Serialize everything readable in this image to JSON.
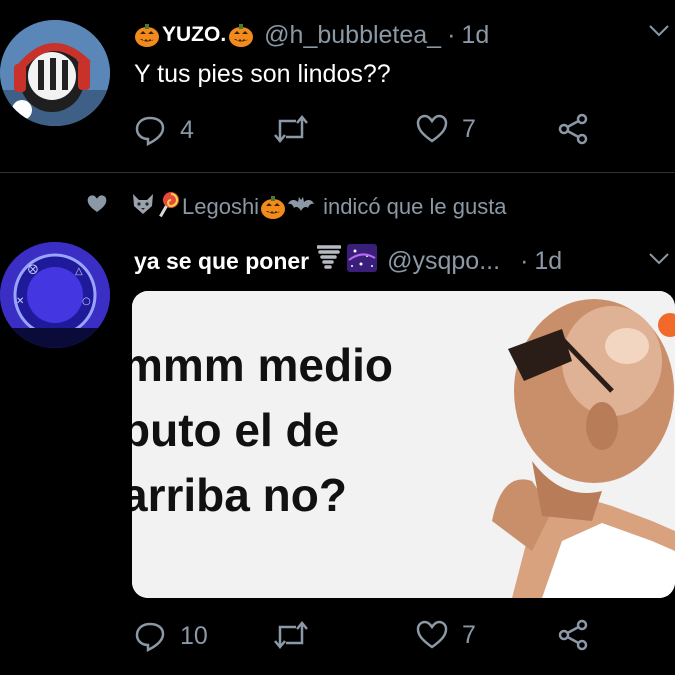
{
  "tweet1": {
    "display_name": "YUZO.",
    "handle": "@h_bubbletea_",
    "separator": "·",
    "time": "1d",
    "text": "Y tus pies son lindos??",
    "replies": "4",
    "retweets": "",
    "likes": "7"
  },
  "social_context": {
    "name": "Legoshi",
    "text": "indicó que le gusta"
  },
  "tweet2": {
    "display_name": "ya se que poner",
    "handle": "@ysqpo...",
    "separator": "·",
    "time": "1d",
    "meme_lines": [
      "mmm medio",
      "puto el de",
      "arriba no?"
    ],
    "replies": "10",
    "retweets": "",
    "likes": "7"
  },
  "icons": [
    "pumpkin-icon",
    "chevron-down-icon",
    "reply-icon",
    "retweet-icon",
    "like-icon",
    "share-icon",
    "heart-filled-icon",
    "wolf-icon",
    "lollipop-icon",
    "bat-icon",
    "tornado-icon",
    "galaxy-icon"
  ],
  "colors": {
    "background": "#000000",
    "muted": "#8b98a5",
    "pumpkin": "#f28b1e",
    "divider": "#2f3336"
  }
}
